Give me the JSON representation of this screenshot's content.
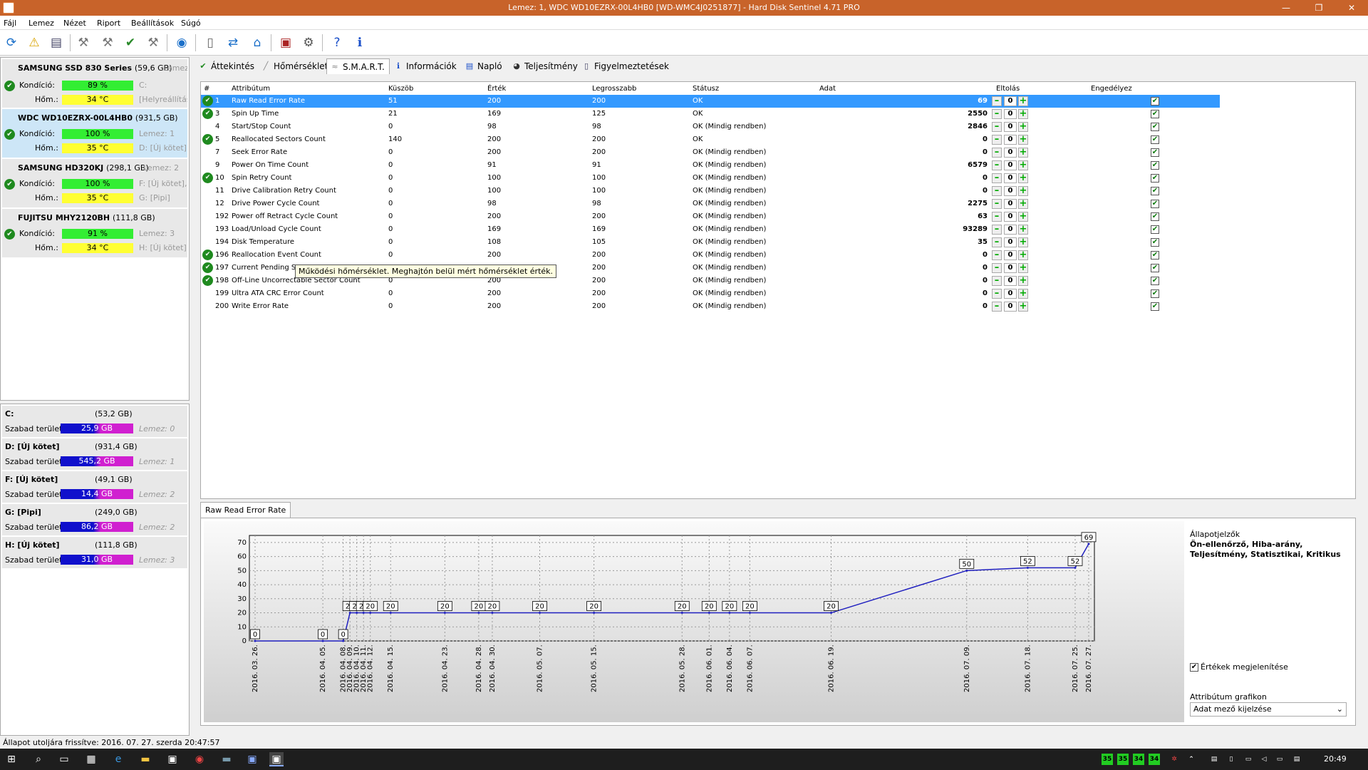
{
  "window": {
    "title": "Lemez: 1, WDC WD10EZRX-00L4HB0 [WD-WMC4J0251877]  -  Hard Disk Sentinel 4.71 PRO",
    "minimize": "—",
    "maximize": "❐",
    "close": "✕"
  },
  "menu": [
    "Fájl",
    "Lemez",
    "Nézet",
    "Riport",
    "Beállítások",
    "Súgó"
  ],
  "disks": [
    {
      "name": "SAMSUNG SSD 830 Series",
      "size": "(59,6 GB)",
      "letter": "Lemez: 0",
      "kondicio_label": "Kondíció:",
      "kondicio": "89 %",
      "hom_label": "Hőm.:",
      "hom": "34 °C",
      "side1": "C:",
      "side2": "[Helyreállítás"
    },
    {
      "name": "WDC WD10EZRX-00L4HB0",
      "size": "(931,5 GB)",
      "letter": "",
      "kondicio_label": "Kondíció:",
      "kondicio": "100 %",
      "hom_label": "Hőm.:",
      "hom": "35 °C",
      "side1": "Lemez: 1",
      "side2": "D: [Új kötet]"
    },
    {
      "name": "SAMSUNG HD320KJ",
      "size": "(298,1 GB)",
      "letter": "Lemez: 2",
      "kondicio_label": "Kondíció:",
      "kondicio": "100 %",
      "hom_label": "Hőm.:",
      "hom": "35 °C",
      "side1": "F: [Új kötet],",
      "side2": "G: [Pipi]"
    },
    {
      "name": "FUJITSU MHY2120BH",
      "size": "(111,8 GB)",
      "letter": "",
      "kondicio_label": "Kondíció:",
      "kondicio": "91 %",
      "hom_label": "Hőm.:",
      "hom": "34 °C",
      "side1": "Lemez: 3",
      "side2": "H: [Új kötet]"
    }
  ],
  "volumes": [
    {
      "name": "C:",
      "size": "(53,2 GB)",
      "free_label": "Szabad terület",
      "free": "25,9 GB",
      "lemez": "Lemez: 0"
    },
    {
      "name": "D: [Új kötet]",
      "size": "(931,4 GB)",
      "free_label": "Szabad terület",
      "free": "545,2 GB",
      "lemez": "Lemez: 1"
    },
    {
      "name": "F: [Új kötet]",
      "size": "(49,1 GB)",
      "free_label": "Szabad terület",
      "free": "14,4 GB",
      "lemez": "Lemez: 2"
    },
    {
      "name": "G: [Pipi]",
      "size": "(249,0 GB)",
      "free_label": "Szabad terület",
      "free": "86,2 GB",
      "lemez": "Lemez: 2"
    },
    {
      "name": "H: [Új kötet]",
      "size": "(111,8 GB)",
      "free_label": "Szabad terület",
      "free": "31,0 GB",
      "lemez": "Lemez: 3"
    }
  ],
  "tabs": [
    "Áttekintés",
    "Hőmérséklet",
    "S.M.A.R.T.",
    "Információk",
    "Napló",
    "Teljesítmény",
    "Figyelmeztetések"
  ],
  "table": {
    "headers": {
      "num": "#",
      "attr": "Attribútum",
      "threshold": "Küszöb",
      "value": "Érték",
      "worst": "Legrosszabb",
      "status": "Státusz",
      "data": "Adat",
      "offset": "Eltolás",
      "enable": "Engedélyez"
    },
    "rows": [
      {
        "num": "1",
        "attr": "Raw Read Error Rate",
        "thr": "51",
        "val": "200",
        "worst": "200",
        "status": "OK",
        "data": "69",
        "off": "0"
      },
      {
        "num": "3",
        "attr": "Spin Up Time",
        "thr": "21",
        "val": "169",
        "worst": "125",
        "status": "OK",
        "data": "2550",
        "off": "0"
      },
      {
        "num": "4",
        "attr": "Start/Stop Count",
        "thr": "0",
        "val": "98",
        "worst": "98",
        "status": "OK (Mindig rendben)",
        "data": "2846",
        "off": "0"
      },
      {
        "num": "5",
        "attr": "Reallocated Sectors Count",
        "thr": "140",
        "val": "200",
        "worst": "200",
        "status": "OK",
        "data": "0",
        "off": "0"
      },
      {
        "num": "7",
        "attr": "Seek Error Rate",
        "thr": "0",
        "val": "200",
        "worst": "200",
        "status": "OK (Mindig rendben)",
        "data": "0",
        "off": "0"
      },
      {
        "num": "9",
        "attr": "Power On Time Count",
        "thr": "0",
        "val": "91",
        "worst": "91",
        "status": "OK (Mindig rendben)",
        "data": "6579",
        "off": "0"
      },
      {
        "num": "10",
        "attr": "Spin Retry Count",
        "thr": "0",
        "val": "100",
        "worst": "100",
        "status": "OK (Mindig rendben)",
        "data": "0",
        "off": "0"
      },
      {
        "num": "11",
        "attr": "Drive Calibration Retry Count",
        "thr": "0",
        "val": "100",
        "worst": "100",
        "status": "OK (Mindig rendben)",
        "data": "0",
        "off": "0"
      },
      {
        "num": "12",
        "attr": "Drive Power Cycle Count",
        "thr": "0",
        "val": "98",
        "worst": "98",
        "status": "OK (Mindig rendben)",
        "data": "2275",
        "off": "0"
      },
      {
        "num": "192",
        "attr": "Power off Retract Cycle Count",
        "thr": "0",
        "val": "200",
        "worst": "200",
        "status": "OK (Mindig rendben)",
        "data": "63",
        "off": "0"
      },
      {
        "num": "193",
        "attr": "Load/Unload Cycle Count",
        "thr": "0",
        "val": "169",
        "worst": "169",
        "status": "OK (Mindig rendben)",
        "data": "93289",
        "off": "0"
      },
      {
        "num": "194",
        "attr": "Disk Temperature",
        "thr": "0",
        "val": "108",
        "worst": "105",
        "status": "OK (Mindig rendben)",
        "data": "35",
        "off": "0"
      },
      {
        "num": "196",
        "attr": "Reallocation Event Count",
        "thr": "0",
        "val": "200",
        "worst": "200",
        "status": "OK (Mindig rendben)",
        "data": "0",
        "off": "0"
      },
      {
        "num": "197",
        "attr": "Current Pending Sector Count",
        "thr": "0",
        "val": "200",
        "worst": "200",
        "status": "OK (Mindig rendben)",
        "data": "0",
        "off": "0"
      },
      {
        "num": "198",
        "attr": "Off-Line Uncorrectable Sector Count",
        "thr": "0",
        "val": "200",
        "worst": "200",
        "status": "OK (Mindig rendben)",
        "data": "0",
        "off": "0"
      },
      {
        "num": "199",
        "attr": "Ultra ATA CRC Error Count",
        "thr": "0",
        "val": "200",
        "worst": "200",
        "status": "OK (Mindig rendben)",
        "data": "0",
        "off": "0"
      },
      {
        "num": "200",
        "attr": "Write Error Rate",
        "thr": "0",
        "val": "200",
        "worst": "200",
        "status": "OK (Mindig rendben)",
        "data": "0",
        "off": "0"
      }
    ]
  },
  "tooltip": "Működési hőmérséklet. Meghajtón belül mért hőmérséklet érték.",
  "graph_tab": "Raw Read Error Rate",
  "chart_data": {
    "type": "line",
    "title": "",
    "xlabel": "",
    "ylabel": "",
    "ylim": [
      0,
      75
    ],
    "y_ticks": [
      0,
      10,
      20,
      30,
      40,
      50,
      60,
      70
    ],
    "grid": true,
    "series": [
      {
        "color": "#1f1fbf",
        "points": [
          [
            "2016. 03. 26.",
            0
          ],
          [
            "2016. 04. 05.",
            0
          ],
          [
            "2016. 04. 08.",
            0
          ],
          [
            "2016. 04. 09.",
            20
          ],
          [
            "2016. 04. 10.",
            20
          ],
          [
            "2016. 04. 11.",
            20
          ],
          [
            "2016. 04. 12.",
            20
          ],
          [
            "2016. 04. 15.",
            20
          ],
          [
            "2016. 04. 23.",
            20
          ],
          [
            "2016. 04. 28.",
            20
          ],
          [
            "2016. 04. 30.",
            20
          ],
          [
            "2016. 05. 07.",
            20
          ],
          [
            "2016. 05. 15.",
            20
          ],
          [
            "2016. 05. 28.",
            20
          ],
          [
            "2016. 06. 01.",
            20
          ],
          [
            "2016. 06. 04.",
            20
          ],
          [
            "2016. 06. 07.",
            20
          ],
          [
            "2016. 06. 19.",
            20
          ],
          [
            "2016. 07. 09.",
            50
          ],
          [
            "2016. 07. 18.",
            52
          ],
          [
            "2016. 07. 25.",
            52
          ],
          [
            "2016. 07. 27.",
            69
          ]
        ]
      }
    ]
  },
  "legend_panel": {
    "title": "Állapotjelzők",
    "body": "Ön-ellenőrző, Hiba-arány, Teljesítmény, Statisztikai, Kritikus",
    "show_values": "Értékek megjelenítése",
    "attr_graph_label": "Attribútum grafikon",
    "attr_graph_value": "Adat mező kijelzése"
  },
  "status": "Állapot utoljára frissítve: 2016. 07. 27. szerda 20:47:57",
  "taskbar": {
    "time": "20:49",
    "temps": [
      "35",
      "35",
      "34",
      "34"
    ]
  }
}
